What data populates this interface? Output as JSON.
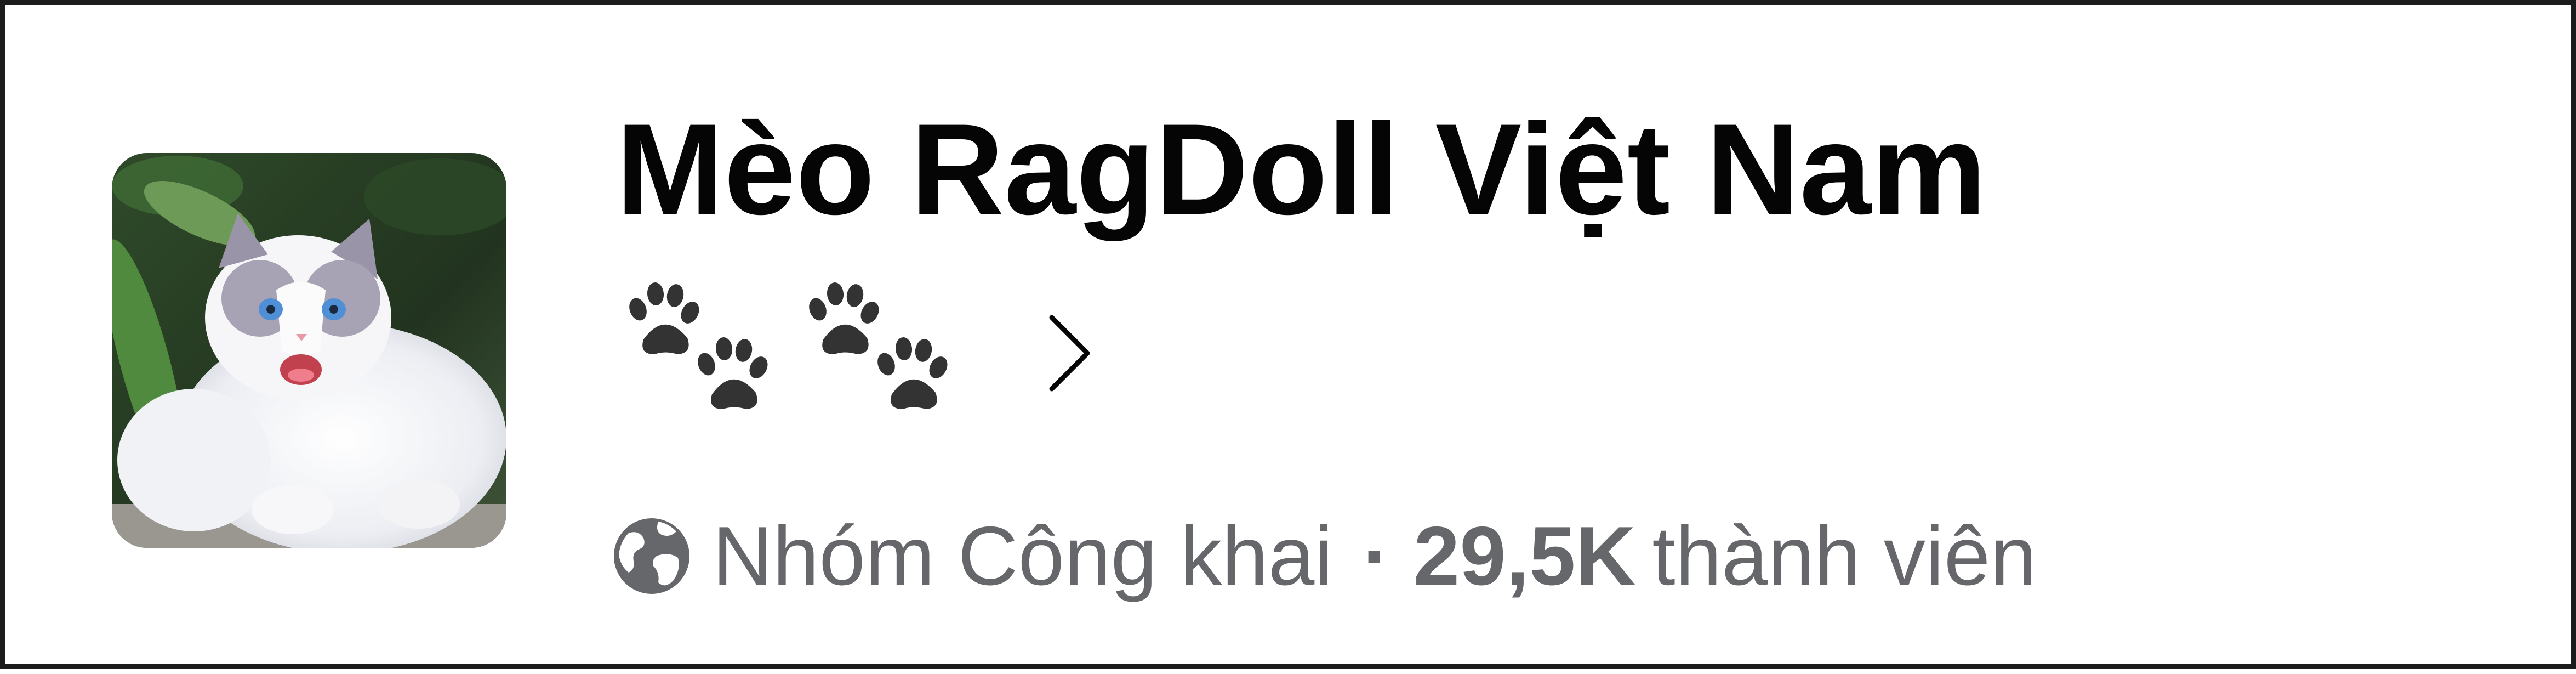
{
  "group": {
    "name": "Mèo RagDoll Việt Nam",
    "emoji_count": 2,
    "emoji": "paw-prints",
    "privacy": "Nhóm Công khai",
    "separator": "·",
    "member_count": "29,5K",
    "member_label": "thành viên"
  },
  "icons": {
    "chevron": "chevron-right-icon",
    "globe": "globe-icon",
    "paw": "paw-prints-icon"
  },
  "colors": {
    "title": "#050505",
    "secondary": "#65676b",
    "paw": "#333333",
    "frame": "#1c1c1c"
  }
}
